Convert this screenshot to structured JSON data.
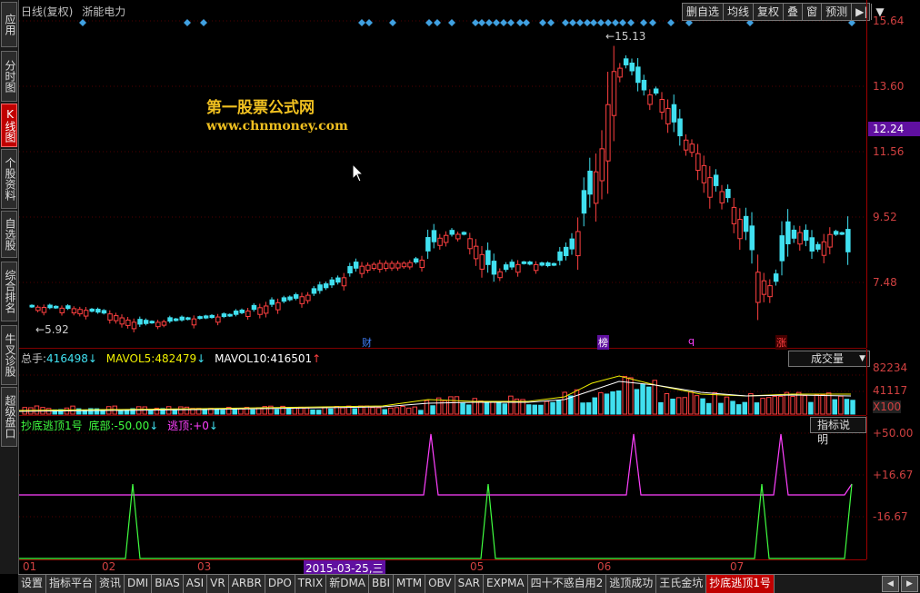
{
  "left_tabs": [
    {
      "label": "应用",
      "active": false
    },
    {
      "label": "分时图",
      "active": false
    },
    {
      "label": "K线图",
      "active": true
    },
    {
      "label": "个股资料",
      "active": false
    },
    {
      "label": "自选股",
      "active": false
    },
    {
      "label": "综合排名",
      "active": false
    },
    {
      "label": "牛叉诊股",
      "active": false
    },
    {
      "label": "超级盘口",
      "active": false
    }
  ],
  "header": {
    "period": "日线(复权)",
    "stock_name": "浙能电力"
  },
  "toolbar": {
    "items": [
      "删自选",
      "均线",
      "复权",
      "叠",
      "窗",
      "预测"
    ],
    "nav_icon": "▶|",
    "dropdown_icon": "▼"
  },
  "watermark": {
    "line1": "第一股票公式网",
    "line2": "www.chnmoney.com"
  },
  "price_axis": [
    "15.64",
    "13.60",
    "11.56",
    "9.52",
    "7.48"
  ],
  "current_price": "12.24",
  "annotations": {
    "high": "15.13",
    "low": "5.92"
  },
  "event_marks": [
    "财",
    "榜",
    "q",
    "涨"
  ],
  "volume": {
    "label_prefix": "总手:",
    "value": "416498",
    "mavol5_label": "MAVOL5:",
    "mavol5": "482479",
    "mavol10_label": "MAVOL10:",
    "mavol10": "416501",
    "selector": "成交量",
    "axis": [
      "82234",
      "41117",
      "X100"
    ]
  },
  "indicator": {
    "name": "抄底逃顶1号",
    "bottom_label": "底部:",
    "bottom_value": "-50.00",
    "top_label": "逃顶:",
    "top_value": "+0",
    "help": "指标说明",
    "axis": [
      "+50.00",
      "+16.67",
      "-16.67"
    ]
  },
  "date_axis": {
    "labels": [
      "01",
      "02",
      "03",
      "05",
      "06",
      "07"
    ],
    "cursor_date": "2015-03-25,三"
  },
  "bottom_tabs": [
    "设置",
    "指标平台",
    "资讯",
    "DMI",
    "BIAS",
    "ASI",
    "VR",
    "ARBR",
    "DPO",
    "TRIX",
    "新DMA",
    "BBI",
    "MTM",
    "OBV",
    "SAR",
    "EXPMA",
    "四十不惑自用2",
    "逃顶成功",
    "王氏金坑",
    "抄底逃顶1号"
  ],
  "active_bottom_tab": "抄底逃顶1号",
  "colors": {
    "up": "#ff4040",
    "down": "#40e0f0",
    "axis": "#a00000",
    "purple": "#ff40ff",
    "green": "#40ff40",
    "cursor_badge": "#6010a0"
  }
}
